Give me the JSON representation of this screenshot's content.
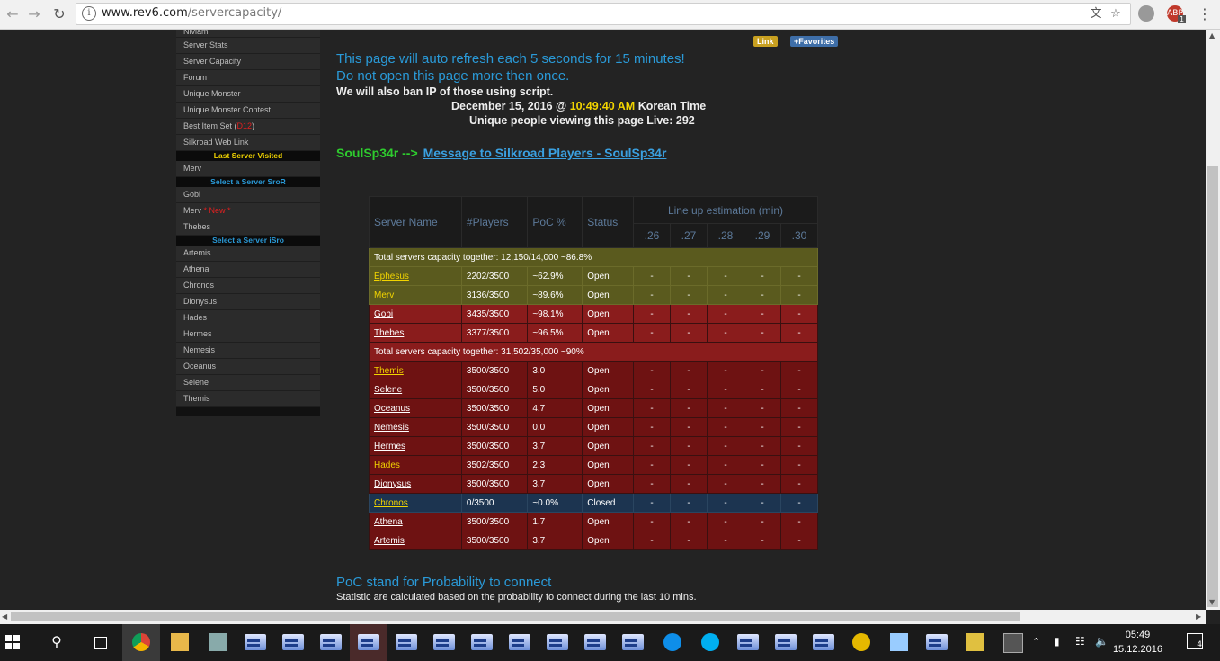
{
  "browser": {
    "url_host": "www.rev6.com",
    "url_path": "/servercapacity/",
    "ext_badge": "1",
    "ext_label": "ABP"
  },
  "sidebar": {
    "items_top": [
      "Nivlam",
      "Server Stats",
      "Server Capacity",
      "Forum",
      "Unique Monster",
      "Unique Monster Contest"
    ],
    "best_item": "Best Item Set (",
    "best_item_red": "D12",
    "best_item_end": ")",
    "web_link": "Silkroad Web Link",
    "hdr_last": "Last Server Visited",
    "last_server": "Merv",
    "hdr_sror": "Select a Server SroR",
    "sror": [
      "Gobi"
    ],
    "merv_new": "Merv",
    "merv_new_tag": "* New *",
    "thebes": "Thebes",
    "hdr_isro": "Select a Server iSro",
    "isro": [
      "Artemis",
      "Athena",
      "Chronos",
      "Dionysus",
      "Hades",
      "Hermes",
      "Nemesis",
      "Oceanus",
      "Selene",
      "Themis"
    ]
  },
  "badges": {
    "link": "Link",
    "favorites": "+Favorites"
  },
  "notice": {
    "line1": "This page will auto refresh each 5 seconds for 15 minutes!",
    "line2": "Do not open this page more then once.",
    "line3": "We will also ban IP of those using script.",
    "date": "December 15, 2016 @ ",
    "time": "10:49:40 AM",
    "tz": " Korean Time",
    "viewers": "Unique people viewing this page Live: 292"
  },
  "message": {
    "author": "SoulSp34r -->",
    "link": "Message to Silkroad Players - SoulSp34r"
  },
  "table": {
    "headers": {
      "name": "Server Name",
      "players": "#Players",
      "poc": "PoC %",
      "status": "Status",
      "lineup": "Line up estimation (min)"
    },
    "lineup_cols": [
      ".26",
      ".27",
      ".28",
      ".29",
      ".30"
    ],
    "total1": "Total servers capacity together: 12,150/14,000 ~86.8%",
    "total2": "Total servers capacity together: 31,502/35,000 ~90%",
    "dash": "-",
    "rows": [
      {
        "name": "Ephesus",
        "players": "2202/3500",
        "poc": "~62.9%",
        "status": "Open"
      },
      {
        "name": "Merv",
        "players": "3136/3500",
        "poc": "~89.6%",
        "status": "Open"
      },
      {
        "name": "Gobi",
        "players": "3435/3500",
        "poc": "~98.1%",
        "status": "Open"
      },
      {
        "name": "Thebes",
        "players": "3377/3500",
        "poc": "~96.5%",
        "status": "Open"
      },
      {
        "name": "Themis",
        "players": "3500/3500",
        "poc": "3.0",
        "status": "Open"
      },
      {
        "name": "Selene",
        "players": "3500/3500",
        "poc": "5.0",
        "status": "Open"
      },
      {
        "name": "Oceanus",
        "players": "3500/3500",
        "poc": "4.7",
        "status": "Open"
      },
      {
        "name": "Nemesis",
        "players": "3500/3500",
        "poc": "0.0",
        "status": "Open"
      },
      {
        "name": "Hermes",
        "players": "3500/3500",
        "poc": "3.7",
        "status": "Open"
      },
      {
        "name": "Hades",
        "players": "3502/3500",
        "poc": "2.3",
        "status": "Open"
      },
      {
        "name": "Dionysus",
        "players": "3500/3500",
        "poc": "3.7",
        "status": "Open"
      },
      {
        "name": "Chronos",
        "players": "0/3500",
        "poc": "~0.0%",
        "status": "Closed"
      },
      {
        "name": "Athena",
        "players": "3500/3500",
        "poc": "1.7",
        "status": "Open"
      },
      {
        "name": "Artemis",
        "players": "3500/3500",
        "poc": "3.7",
        "status": "Open"
      }
    ]
  },
  "footer": {
    "poc_title": "PoC stand for Probability to connect",
    "stat_note": "Statistic are calculated based on the probability to connect during the last 10 mins."
  },
  "taskbar": {
    "time": "05:49",
    "date": "15.12.2016",
    "notif_count": "4"
  }
}
